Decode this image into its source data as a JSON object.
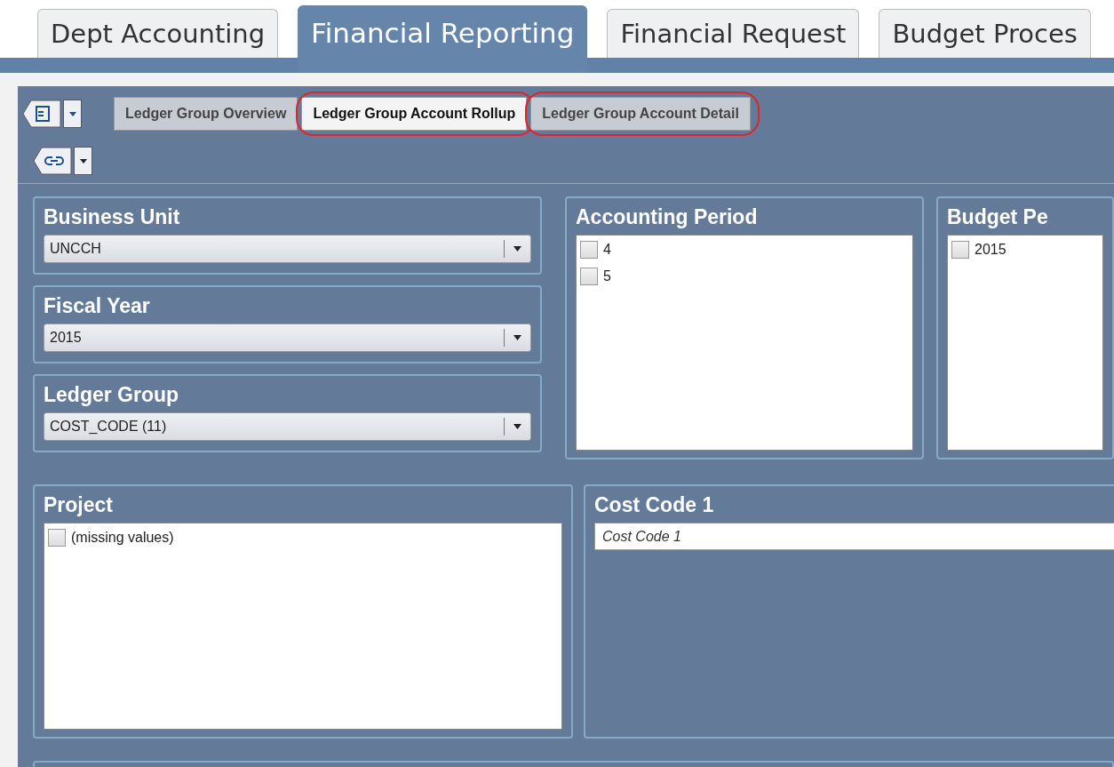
{
  "app_tabs": [
    {
      "label": "Dept Accounting",
      "selected": false
    },
    {
      "label": "Financial Reporting",
      "selected": true
    },
    {
      "label": "Financial Request",
      "selected": false
    },
    {
      "label": "Budget Proces",
      "selected": false
    }
  ],
  "sheet_tabs": [
    {
      "label": "Ledger Group Overview",
      "selected": false,
      "highlighted": false
    },
    {
      "label": "Ledger Group Account Rollup",
      "selected": true,
      "highlighted": true
    },
    {
      "label": "Ledger Group Account Detail",
      "selected": false,
      "highlighted": true
    }
  ],
  "filters": [
    {
      "kind": "dropdown",
      "title": "Business Unit",
      "value": "UNCCH"
    },
    {
      "kind": "dropdown",
      "title": "Fiscal Year",
      "value": "2015"
    },
    {
      "kind": "dropdown",
      "title": "Ledger Group",
      "value": "COST_CODE (11)"
    },
    {
      "kind": "list",
      "title": "Accounting Period",
      "items": [
        {
          "label": "4",
          "checked": false
        },
        {
          "label": "5",
          "checked": false
        }
      ]
    },
    {
      "kind": "list",
      "title": "Budget Pe",
      "items": [
        {
          "label": "2015",
          "checked": false
        }
      ]
    },
    {
      "kind": "list",
      "title": "Project",
      "items": [
        {
          "label": "(missing values)",
          "checked": false
        }
      ]
    },
    {
      "kind": "search",
      "title": "Cost Code 1",
      "placeholder": "Cost Code 1"
    }
  ]
}
